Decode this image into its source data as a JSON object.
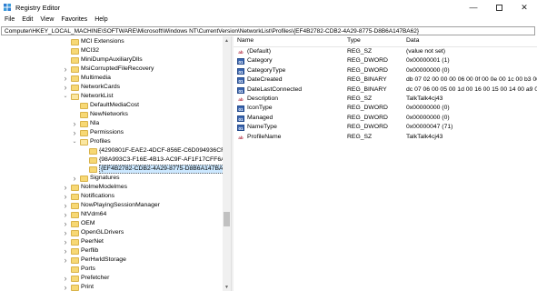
{
  "window": {
    "title": "Registry Editor"
  },
  "menu": [
    "File",
    "Edit",
    "View",
    "Favorites",
    "Help"
  ],
  "address": "Computer\\HKEY_LOCAL_MACHINE\\SOFTWARE\\Microsoft\\Windows NT\\CurrentVersion\\NetworkList\\Profiles\\{EF4B2782-CDB2-4A29-8775-D8B6A147BA62}",
  "tree": [
    {
      "label": "MCI Extensions",
      "depth": 0,
      "expander": "none"
    },
    {
      "label": "MCI32",
      "depth": 0,
      "expander": "none"
    },
    {
      "label": "MiniDumpAuxiliaryDlls",
      "depth": 0,
      "expander": "none"
    },
    {
      "label": "MsiCorruptedFileRecovery",
      "depth": 0,
      "expander": "collapsed"
    },
    {
      "label": "Multimedia",
      "depth": 0,
      "expander": "collapsed"
    },
    {
      "label": "NetworkCards",
      "depth": 0,
      "expander": "collapsed"
    },
    {
      "label": "NetworkList",
      "depth": 0,
      "expander": "expanded"
    },
    {
      "label": "DefaultMediaCost",
      "depth": 1,
      "expander": "none"
    },
    {
      "label": "NewNetworks",
      "depth": 1,
      "expander": "none"
    },
    {
      "label": "Nla",
      "depth": 1,
      "expander": "collapsed"
    },
    {
      "label": "Permissions",
      "depth": 1,
      "expander": "collapsed"
    },
    {
      "label": "Profiles",
      "depth": 1,
      "expander": "expanded"
    },
    {
      "label": "{4290801F-EAE2-4DCF-856E-C6D094936CFC}",
      "depth": 2,
      "expander": "none"
    },
    {
      "label": "{98A993C3-F16E-4B13-AC9F-AF1F17CFF6A7}",
      "depth": 2,
      "expander": "none"
    },
    {
      "label": "{EF4B2782-CDB2-4A29-8775-D8B6A147BA62}",
      "depth": 2,
      "expander": "none",
      "selected": true
    },
    {
      "label": "Signatures",
      "depth": 1,
      "expander": "collapsed"
    },
    {
      "label": "NolmeModelmes",
      "depth": 0,
      "expander": "collapsed"
    },
    {
      "label": "Notifications",
      "depth": 0,
      "expander": "collapsed"
    },
    {
      "label": "NowPlayingSessionManager",
      "depth": 0,
      "expander": "collapsed"
    },
    {
      "label": "NtVdm64",
      "depth": 0,
      "expander": "collapsed"
    },
    {
      "label": "OEM",
      "depth": 0,
      "expander": "collapsed"
    },
    {
      "label": "OpenGLDrivers",
      "depth": 0,
      "expander": "collapsed"
    },
    {
      "label": "PeerNet",
      "depth": 0,
      "expander": "collapsed"
    },
    {
      "label": "Perflib",
      "depth": 0,
      "expander": "collapsed"
    },
    {
      "label": "PerHwIdStorage",
      "depth": 0,
      "expander": "collapsed"
    },
    {
      "label": "Ports",
      "depth": 0,
      "expander": "none"
    },
    {
      "label": "Prefetcher",
      "depth": 0,
      "expander": "collapsed"
    },
    {
      "label": "Print",
      "depth": 0,
      "expander": "collapsed"
    }
  ],
  "columns": {
    "name": "Name",
    "type": "Type",
    "data": "Data"
  },
  "values": [
    {
      "name": "(Default)",
      "type": "REG_SZ",
      "data": "(value not set)",
      "icon": "sz"
    },
    {
      "name": "Category",
      "type": "REG_DWORD",
      "data": "0x00000001 (1)",
      "icon": "bin"
    },
    {
      "name": "CategoryType",
      "type": "REG_DWORD",
      "data": "0x00000000 (0)",
      "icon": "bin"
    },
    {
      "name": "DateCreated",
      "type": "REG_BINARY",
      "data": "db 07 02 00 00 00 06 00 0f 00 0e 00 1c 00 b3 00",
      "icon": "bin"
    },
    {
      "name": "DateLastConnected",
      "type": "REG_BINARY",
      "data": "dc 07 06 00 05 00 1d 00 16 00 15 00 14 00 a9 02",
      "icon": "bin"
    },
    {
      "name": "Description",
      "type": "REG_SZ",
      "data": "TalkTalk4cj43",
      "icon": "sz"
    },
    {
      "name": "IconType",
      "type": "REG_DWORD",
      "data": "0x00000000 (0)",
      "icon": "bin"
    },
    {
      "name": "Managed",
      "type": "REG_DWORD",
      "data": "0x00000000 (0)",
      "icon": "bin"
    },
    {
      "name": "NameType",
      "type": "REG_DWORD",
      "data": "0x00000047 (71)",
      "icon": "bin"
    },
    {
      "name": "ProfileName",
      "type": "REG_SZ",
      "data": "TalkTalk4cj43",
      "icon": "sz"
    }
  ],
  "icons": {
    "app": "registry-editor-icon",
    "folder": "folder-icon",
    "string_value": "ab",
    "binary_value": "01"
  }
}
